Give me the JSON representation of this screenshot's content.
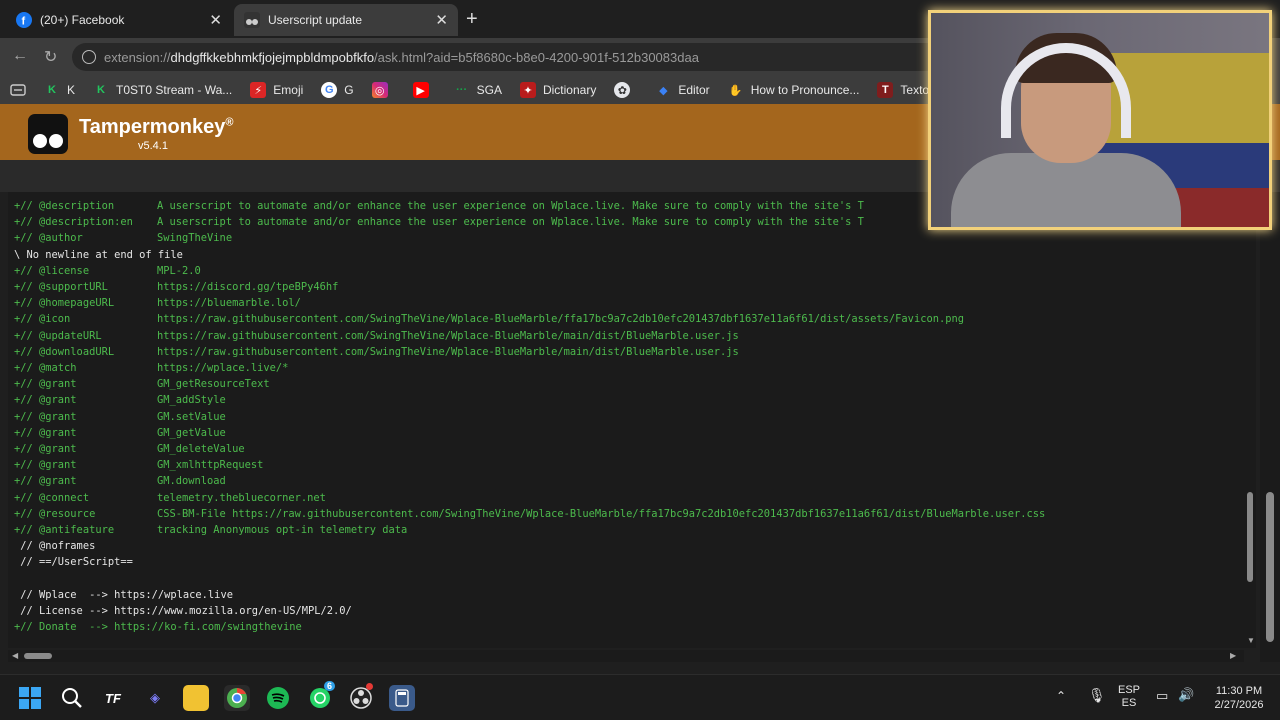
{
  "tabs": [
    {
      "title": "(20+) Facebook",
      "active": false,
      "icon": "facebook-icon"
    },
    {
      "title": "Userscript update",
      "active": true,
      "icon": "tampermonkey-icon"
    }
  ],
  "address": {
    "scheme": "extension://",
    "host": "dhdgffkkebhmkfjojejmpbldmpobfkfo",
    "path": "/ask.html?aid=b5f8680c-b8e0-4200-901f-512b30083daa"
  },
  "bookmarks": [
    {
      "label": "K",
      "icon": "k-icon",
      "color": "#22c55e"
    },
    {
      "label": "T0ST0 Stream - Wa...",
      "icon": "kick-icon",
      "color": "#22c55e"
    },
    {
      "label": "Emoji",
      "icon": "emoji-icon",
      "color": "#dc2626"
    },
    {
      "label": "G",
      "icon": "google-icon",
      "color": "#4285f4"
    },
    {
      "label": "",
      "icon": "instagram-icon",
      "color": "#d62976"
    },
    {
      "label": "",
      "icon": "youtube-icon",
      "color": "#ff0000"
    },
    {
      "label": "SGA",
      "icon": "sga-icon",
      "color": "#16a34a"
    },
    {
      "label": "Dictionary",
      "icon": "dictionary-icon",
      "color": "#b91c1c"
    },
    {
      "label": "",
      "icon": "openai-icon",
      "color": "#9ca3af"
    },
    {
      "label": "Editor",
      "icon": "editor-icon",
      "color": "#3b82f6"
    },
    {
      "label": "How to Pronounce...",
      "icon": "pronounce-icon",
      "color": "#e5e7eb"
    },
    {
      "label": "Texto Yt",
      "icon": "texto-icon",
      "color": "#dc2626"
    }
  ],
  "extension": {
    "name": "Tampermonkey",
    "trademark": "®",
    "version": "v5.4.1"
  },
  "code_lines": [
    {
      "prefix": "+// @description",
      "value": "A userscript to automate and/or enhance the user experience on Wplace.live. Make sure to comply with the site's T",
      "color": "green"
    },
    {
      "prefix": "+// @description:en",
      "value": "A userscript to automate and/or enhance the user experience on Wplace.live. Make sure to comply with the site's T",
      "color": "green"
    },
    {
      "prefix": "+// @author",
      "value": "SwingTheVine",
      "color": "green"
    },
    {
      "prefix": "\\ No newline at end of file",
      "value": "",
      "color": "white"
    },
    {
      "prefix": "+// @license",
      "value": "MPL-2.0",
      "color": "green"
    },
    {
      "prefix": "+// @supportURL",
      "value": "https://discord.gg/tpeBPy46hf",
      "color": "green"
    },
    {
      "prefix": "+// @homepageURL",
      "value": "https://bluemarble.lol/",
      "color": "green"
    },
    {
      "prefix": "+// @icon",
      "value": "https://raw.githubusercontent.com/SwingTheVine/Wplace-BlueMarble/ffa17bc9a7c2db10efc201437dbf1637e11a6f61/dist/assets/Favicon.png",
      "color": "green"
    },
    {
      "prefix": "+// @updateURL",
      "value": "https://raw.githubusercontent.com/SwingTheVine/Wplace-BlueMarble/main/dist/BlueMarble.user.js",
      "color": "green"
    },
    {
      "prefix": "+// @downloadURL",
      "value": "https://raw.githubusercontent.com/SwingTheVine/Wplace-BlueMarble/main/dist/BlueMarble.user.js",
      "color": "green"
    },
    {
      "prefix": "+// @match",
      "value": "https://wplace.live/*",
      "color": "green"
    },
    {
      "prefix": "+// @grant",
      "value": "GM_getResourceText",
      "color": "green"
    },
    {
      "prefix": "+// @grant",
      "value": "GM_addStyle",
      "color": "green"
    },
    {
      "prefix": "+// @grant",
      "value": "GM.setValue",
      "color": "green"
    },
    {
      "prefix": "+// @grant",
      "value": "GM_getValue",
      "color": "green"
    },
    {
      "prefix": "+// @grant",
      "value": "GM_deleteValue",
      "color": "green"
    },
    {
      "prefix": "+// @grant",
      "value": "GM_xmlhttpRequest",
      "color": "green"
    },
    {
      "prefix": "+// @grant",
      "value": "GM.download",
      "color": "green"
    },
    {
      "prefix": "+// @connect",
      "value": "telemetry.thebluecorner.net",
      "color": "green"
    },
    {
      "prefix": "+// @resource",
      "value": "CSS-BM-File https://raw.githubusercontent.com/SwingTheVine/Wplace-BlueMarble/ffa17bc9a7c2db10efc201437dbf1637e11a6f61/dist/BlueMarble.user.css",
      "color": "green"
    },
    {
      "prefix": "+// @antifeature",
      "value": "tracking Anonymous opt-in telemetry data",
      "color": "green"
    },
    {
      "prefix": " // @noframes",
      "value": "",
      "color": "white"
    },
    {
      "prefix": " // ==/UserScript==",
      "value": "",
      "color": "white"
    },
    {
      "prefix": "",
      "value": "",
      "color": "white"
    },
    {
      "prefix": " // Wplace  --> https://wplace.live",
      "value": "",
      "color": "white"
    },
    {
      "prefix": " // License --> https://www.mozilla.org/en-US/MPL/2.0/",
      "value": "",
      "color": "white"
    },
    {
      "prefix": "+// Donate  --> https://ko-fi.com/swingthevine",
      "value": "",
      "color": "green"
    }
  ],
  "taskbar": {
    "apps": [
      "windows-start-icon",
      "search-icon",
      "tf-app-icon",
      "vscode-like-icon",
      "file-explorer-icon",
      "chrome-icon",
      "spotify-icon",
      "whatsapp-icon",
      "obs-icon",
      "calculator-icon"
    ],
    "whatsapp_badge": "6",
    "language": "ESP",
    "region": "ES",
    "time": "11:30 PM",
    "date": "2/27/2026"
  }
}
